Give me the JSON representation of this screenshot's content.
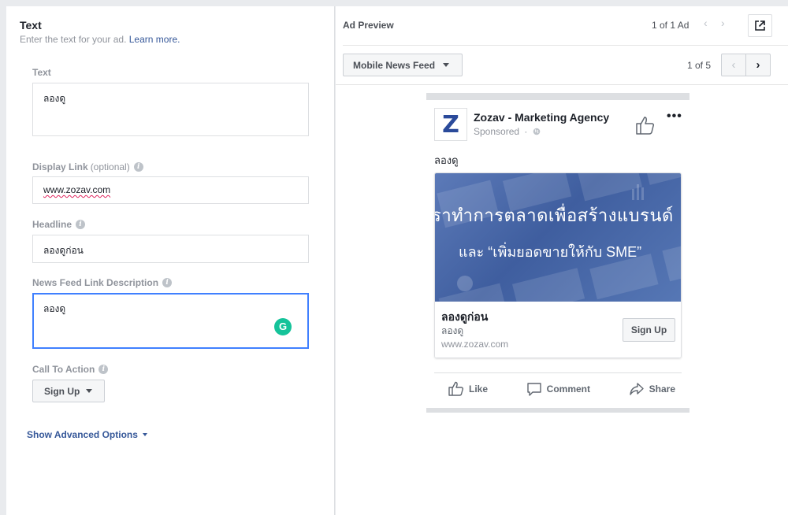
{
  "left": {
    "section_title": "Text",
    "section_subtitle": "Enter the text for your ad.",
    "learn_more": "Learn more.",
    "text_label": "Text",
    "text_value": "ลองดู",
    "display_link_label": "Display Link",
    "display_link_optional": "(optional)",
    "display_link_value": "www.zozav.com",
    "headline_label": "Headline",
    "headline_value": "ลองดูก่อน",
    "nf_desc_label": "News Feed Link Description",
    "nf_desc_value": "ลองดู",
    "cta_label": "Call To Action",
    "cta_value": "Sign Up",
    "advanced": "Show Advanced Options"
  },
  "right": {
    "title": "Ad Preview",
    "ad_count": "1 of 1 Ad",
    "placement": "Mobile News Feed",
    "page_count": "1 of 5"
  },
  "ad": {
    "logo_letter": "Z",
    "page_name": "Zozav - Marketing Agency",
    "sponsored": "Sponsored",
    "primary_text": "ลองดู",
    "image_line1": "ราทำการตลาดเพื่อสร้างแบรนด์",
    "image_line2": "และ “เพิ่มยอดขายให้กับ SME”",
    "headline": "ลองดูก่อน",
    "description": "ลองดู",
    "link": "www.zozav.com",
    "cta": "Sign Up",
    "like": "Like",
    "comment": "Comment",
    "share": "Share"
  },
  "icons": {
    "info": "info-icon",
    "external": "external-link-icon",
    "grammarly": "grammarly-icon"
  },
  "colors": {
    "link": "#365899",
    "focus": "#4080ff",
    "grammarly": "#15c39a",
    "ad_image": "#4a6aa9"
  }
}
